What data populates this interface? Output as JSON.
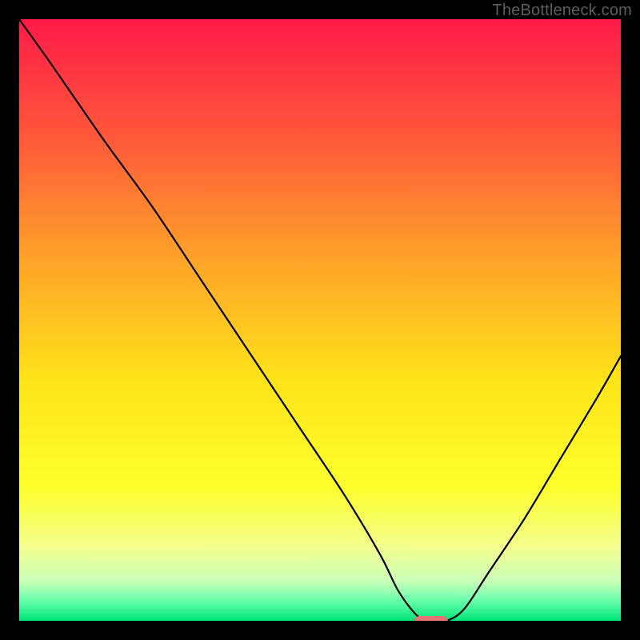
{
  "watermark": "TheBottleneck.com",
  "chart_data": {
    "type": "line",
    "title": "",
    "xlabel": "",
    "ylabel": "",
    "xlim": [
      0,
      100
    ],
    "ylim": [
      0,
      100
    ],
    "gradient_stops": [
      {
        "offset": 0.0,
        "color": "#ff1a49"
      },
      {
        "offset": 0.2,
        "color": "#ff5a3a"
      },
      {
        "offset": 0.4,
        "color": "#ffa329"
      },
      {
        "offset": 0.6,
        "color": "#ffe41a"
      },
      {
        "offset": 0.78,
        "color": "#fdff2d"
      },
      {
        "offset": 0.88,
        "color": "#f3ff92"
      },
      {
        "offset": 0.935,
        "color": "#c8ffb8"
      },
      {
        "offset": 0.965,
        "color": "#6dffad"
      },
      {
        "offset": 1.0,
        "color": "#00e47a"
      }
    ],
    "series": [
      {
        "name": "bottleneck-curve",
        "x": [
          0,
          5,
          14,
          22,
          30,
          38,
          46,
          54,
          60,
          63,
          66,
          68,
          71,
          74,
          78,
          84,
          90,
          96,
          100
        ],
        "y": [
          100,
          93,
          80,
          69,
          57,
          45,
          33,
          21,
          11,
          5,
          1,
          0,
          0,
          2,
          8,
          17,
          27,
          37,
          44
        ]
      }
    ],
    "marker": {
      "name": "optimal-marker",
      "x": 68.5,
      "y": 0,
      "width": 5.5,
      "height": 1.6,
      "color": "#e57373"
    }
  }
}
